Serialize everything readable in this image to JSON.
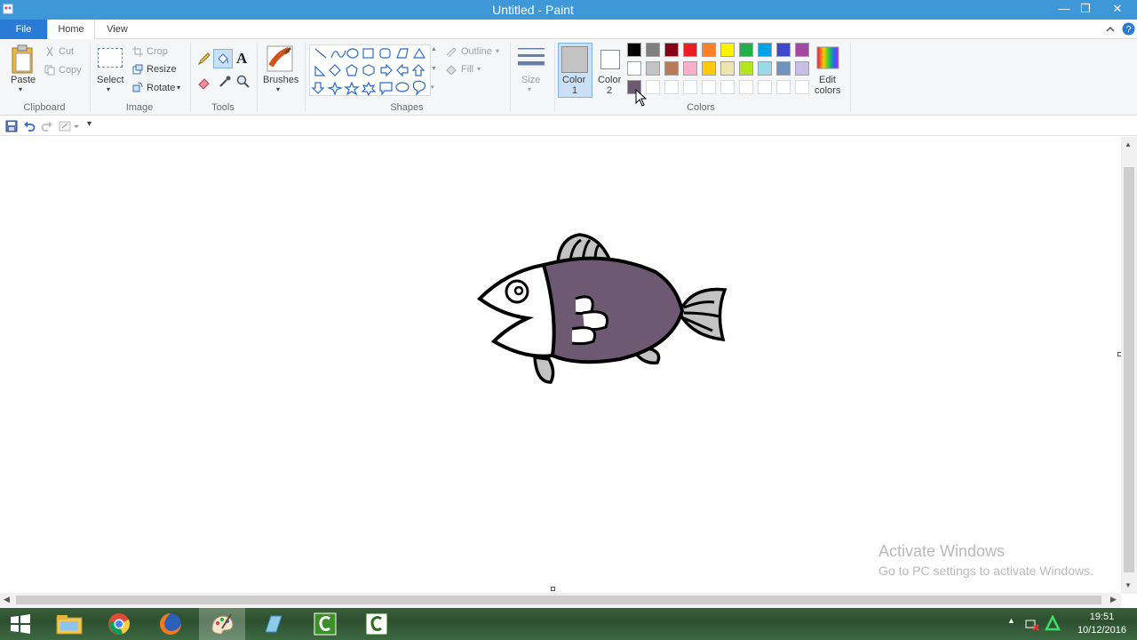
{
  "window": {
    "title": "Untitled - Paint",
    "minimize_glyph": "—",
    "restore_glyph": "❐",
    "close_glyph": "✕"
  },
  "tabs": {
    "file": "File",
    "home": "Home",
    "view": "View"
  },
  "clipboard": {
    "paste": "Paste",
    "cut": "Cut",
    "copy": "Copy",
    "group": "Clipboard"
  },
  "image": {
    "select": "Select",
    "crop": "Crop",
    "resize": "Resize",
    "rotate": "Rotate",
    "group": "Image"
  },
  "tools": {
    "group": "Tools",
    "text_tool": "A"
  },
  "brushes": {
    "label": "Brushes"
  },
  "shapes": {
    "outline": "Outline",
    "fill": "Fill",
    "group": "Shapes"
  },
  "size": {
    "label": "Size"
  },
  "colors": {
    "color1_label": "Color",
    "color1_num": "1",
    "color2_label": "Color",
    "color2_num": "2",
    "edit_label": "Edit",
    "edit_label2": "colors",
    "group": "Colors",
    "color1_value": "#c3c3c3",
    "color2_value": "#ffffff",
    "palette_row1": [
      "#000000",
      "#7f7f7f",
      "#880015",
      "#ed1c24",
      "#ff7f27",
      "#fff200",
      "#22b14c",
      "#00a2e8",
      "#3f48cc",
      "#a349a4"
    ],
    "palette_row2": [
      "#ffffff",
      "#c3c3c3",
      "#b97a57",
      "#ffaec9",
      "#ffc90e",
      "#efe4b0",
      "#b5e61d",
      "#99d9ea",
      "#7092be",
      "#c8bfe7"
    ],
    "palette_row3": [
      "#6d5a72",
      "#ffffff",
      "#ffffff",
      "#ffffff",
      "#ffffff",
      "#ffffff",
      "#ffffff",
      "#ffffff",
      "#ffffff",
      "#ffffff"
    ],
    "fish_body": "#6d5a72",
    "fish_fins": "#c3c3c3"
  },
  "watermark": {
    "line1": "Activate Windows",
    "line2": "Go to PC settings to activate Windows."
  },
  "taskbar": {
    "time": "19:51",
    "date": "10/12/2016"
  }
}
